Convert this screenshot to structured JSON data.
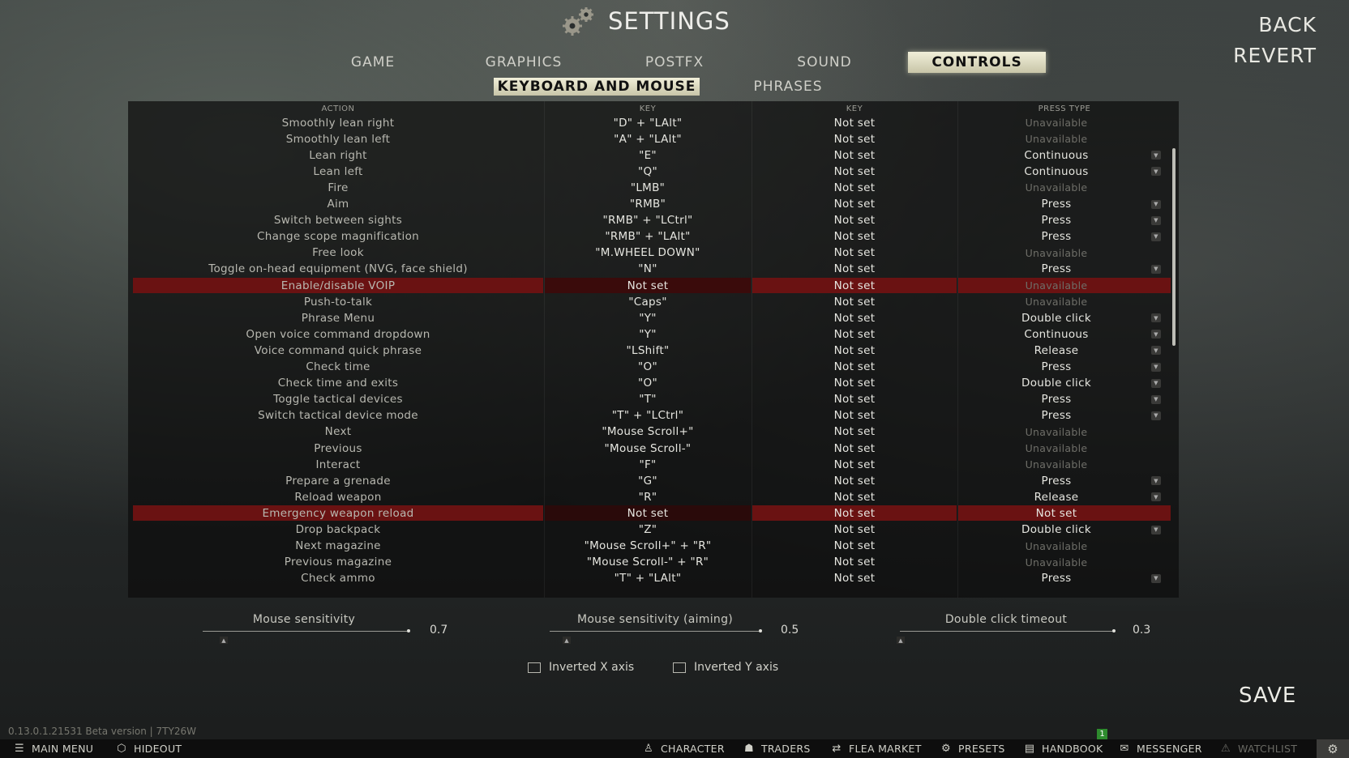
{
  "header": {
    "title": "SETTINGS",
    "back": "BACK",
    "revert": "REVERT"
  },
  "tabs": [
    "GAME",
    "GRAPHICS",
    "POSTFX",
    "SOUND",
    "CONTROLS"
  ],
  "active_tab": "CONTROLS",
  "subtabs": [
    "KEYBOARD AND MOUSE",
    "PHRASES"
  ],
  "active_subtab": "KEYBOARD AND MOUSE",
  "columns": {
    "action": "ACTION",
    "key1": "KEY",
    "key2": "KEY",
    "press_type": "PRESS TYPE"
  },
  "rows": [
    {
      "action": "Smoothly lean right",
      "key1": "\"D\" + \"LAlt\"",
      "key2": "Not set",
      "press": "Unavailable"
    },
    {
      "action": "Smoothly lean left",
      "key1": "\"A\" + \"LAlt\"",
      "key2": "Not set",
      "press": "Unavailable"
    },
    {
      "action": "Lean right",
      "key1": "\"E\"",
      "key2": "Not set",
      "press": "Continuous"
    },
    {
      "action": "Lean left",
      "key1": "\"Q\"",
      "key2": "Not set",
      "press": "Continuous"
    },
    {
      "action": "Fire",
      "key1": "\"LMB\"",
      "key2": "Not set",
      "press": "Unavailable"
    },
    {
      "action": "Aim",
      "key1": "\"RMB\"",
      "key2": "Not set",
      "press": "Press"
    },
    {
      "action": "Switch between sights",
      "key1": "\"RMB\" + \"LCtrl\"",
      "key2": "Not set",
      "press": "Press"
    },
    {
      "action": "Change scope magnification",
      "key1": "\"RMB\" + \"LAlt\"",
      "key2": "Not set",
      "press": "Press"
    },
    {
      "action": "Free look",
      "key1": "\"M.WHEEL DOWN\"",
      "key2": "Not set",
      "press": "Unavailable"
    },
    {
      "action": "Toggle on-head equipment (NVG, face shield)",
      "key1": "\"N\"",
      "key2": "Not set",
      "press": "Press"
    },
    {
      "action": "Enable/disable VOIP",
      "key1": "Not set",
      "key2": "Not set",
      "press": "Unavailable"
    },
    {
      "action": "Push-to-talk",
      "key1": "\"Caps\"",
      "key2": "Not set",
      "press": "Unavailable"
    },
    {
      "action": "Phrase Menu",
      "key1": "\"Y\"",
      "key2": "Not set",
      "press": "Double click"
    },
    {
      "action": "Open voice command dropdown",
      "key1": "\"Y\"",
      "key2": "Not set",
      "press": "Continuous"
    },
    {
      "action": "Voice command quick phrase",
      "key1": "\"LShift\"",
      "key2": "Not set",
      "press": "Release"
    },
    {
      "action": "Check time",
      "key1": "\"O\"",
      "key2": "Not set",
      "press": "Press"
    },
    {
      "action": "Check time and exits",
      "key1": "\"O\"",
      "key2": "Not set",
      "press": "Double click"
    },
    {
      "action": "Toggle tactical devices",
      "key1": "\"T\"",
      "key2": "Not set",
      "press": "Press"
    },
    {
      "action": "Switch tactical device mode",
      "key1": "\"T\" + \"LCtrl\"",
      "key2": "Not set",
      "press": "Press"
    },
    {
      "action": "Next",
      "key1": "\"Mouse Scroll+\"",
      "key2": "Not set",
      "press": "Unavailable"
    },
    {
      "action": "Previous",
      "key1": "\"Mouse Scroll-\"",
      "key2": "Not set",
      "press": "Unavailable"
    },
    {
      "action": "Interact",
      "key1": "\"F\"",
      "key2": "Not set",
      "press": "Unavailable"
    },
    {
      "action": "Prepare a grenade",
      "key1": "\"G\"",
      "key2": "Not set",
      "press": "Press"
    },
    {
      "action": "Reload weapon",
      "key1": "\"R\"",
      "key2": "Not set",
      "press": "Release"
    },
    {
      "action": "Emergency weapon reload",
      "key1": "Not set",
      "key2": "Not set",
      "press": "Not set"
    },
    {
      "action": "Drop backpack",
      "key1": "\"Z\"",
      "key2": "Not set",
      "press": "Double click"
    },
    {
      "action": "Next magazine",
      "key1": "\"Mouse Scroll+\" + \"R\"",
      "key2": "Not set",
      "press": "Unavailable"
    },
    {
      "action": "Previous magazine",
      "key1": "\"Mouse Scroll-\" + \"R\"",
      "key2": "Not set",
      "press": "Unavailable"
    },
    {
      "action": "Check ammo",
      "key1": "\"T\" + \"LAlt\"",
      "key2": "Not set",
      "press": "Press"
    }
  ],
  "error_rows": [
    10,
    24
  ],
  "sliders": [
    {
      "label": "Mouse sensitivity",
      "value": "0.7",
      "level": 1.0
    },
    {
      "label": "Mouse sensitivity (aiming)",
      "value": "0.5",
      "level": 1.0
    },
    {
      "label": "Double click timeout",
      "value": "0.3",
      "level": 1.0
    }
  ],
  "checkboxes": [
    {
      "label": "Inverted X axis",
      "checked": false
    },
    {
      "label": "Inverted Y axis",
      "checked": false
    }
  ],
  "save": "SAVE",
  "version": "0.13.0.1.21531 Beta version | 7TY26W",
  "bottom_bar": {
    "main_menu": "MAIN MENU",
    "hideout": "HIDEOUT",
    "character": "CHARACTER",
    "traders": "TRADERS",
    "flea_market": "FLEA MARKET",
    "presets": "PRESETS",
    "handbook": "HANDBOOK",
    "messenger": "MESSENGER",
    "watchlist": "WATCHLIST",
    "notification_count": "1"
  },
  "colors": {
    "accent": "#e8e5cc",
    "error_row": "#6a1212",
    "unavailable": "#6e6e68"
  }
}
